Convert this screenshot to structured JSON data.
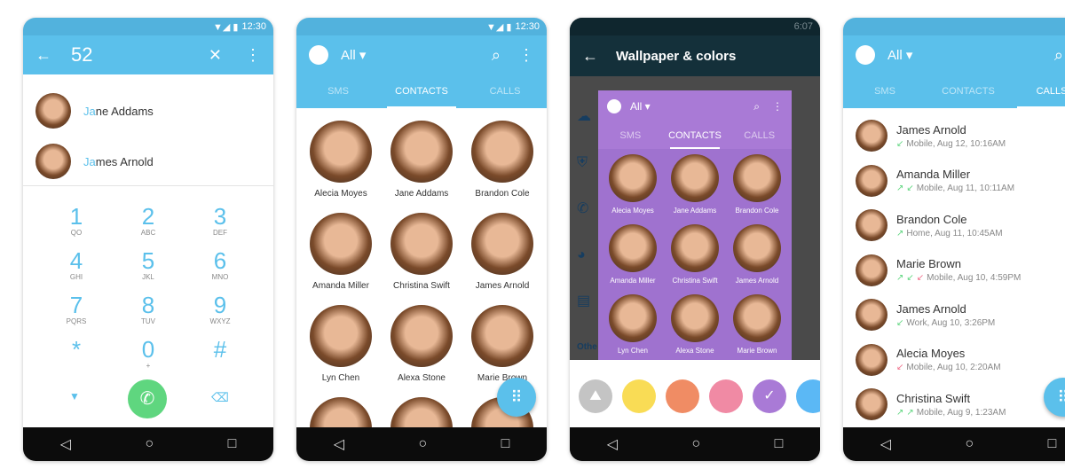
{
  "status": {
    "time1": "12:30",
    "time3": "6:07"
  },
  "dialer": {
    "number": "52",
    "matches": [
      {
        "hl": "Ja",
        "rest": "ne Addams"
      },
      {
        "hl": "Ja",
        "rest": "mes Arnold"
      }
    ],
    "keys": [
      {
        "d": "1",
        "l": "QO"
      },
      {
        "d": "2",
        "l": "ABC"
      },
      {
        "d": "3",
        "l": "DEF"
      },
      {
        "d": "4",
        "l": "GHI"
      },
      {
        "d": "5",
        "l": "JKL"
      },
      {
        "d": "6",
        "l": "MNO"
      },
      {
        "d": "7",
        "l": "PQRS"
      },
      {
        "d": "8",
        "l": "TUV"
      },
      {
        "d": "9",
        "l": "WXYZ"
      },
      {
        "d": "*",
        "l": ""
      },
      {
        "d": "0",
        "l": "+"
      },
      {
        "d": "#",
        "l": ""
      }
    ]
  },
  "header": {
    "filter": "All"
  },
  "tabs": [
    "SMS",
    "CONTACTS",
    "CALLS"
  ],
  "contacts": [
    "Alecia Moyes",
    "Jane Addams",
    "Brandon Cole",
    "Amanda Miller",
    "Christina Swift",
    "James Arnold",
    "Lyn Chen",
    "Alexa Stone",
    "Marie Brown"
  ],
  "wallpaper": {
    "title": "Wallpaper & colors",
    "side_label": "Othe",
    "colors": [
      "#c4c4c4",
      "#f9dc55",
      "#f08c64",
      "#f08aa4",
      "#a97ad6",
      "#5bb8f5"
    ],
    "selected": 4
  },
  "calls": [
    {
      "name": "James Arnold",
      "icons": [
        "in"
      ],
      "detail": "Mobile, Aug 12, 10:16AM"
    },
    {
      "name": "Amanda Miller",
      "icons": [
        "out",
        "in"
      ],
      "detail": "Mobile, Aug 11, 10:11AM"
    },
    {
      "name": "Brandon Cole",
      "icons": [
        "out"
      ],
      "detail": "Home, Aug 11, 10:45AM"
    },
    {
      "name": "Marie Brown",
      "icons": [
        "out",
        "in",
        "missed"
      ],
      "detail": "Mobile, Aug 10, 4:59PM"
    },
    {
      "name": "James Arnold",
      "icons": [
        "in"
      ],
      "detail": "Work, Aug 10, 3:26PM"
    },
    {
      "name": "Alecia Moyes",
      "icons": [
        "missed"
      ],
      "detail": "Mobile, Aug 10, 2:20AM"
    },
    {
      "name": "Christina Swift",
      "icons": [
        "out",
        "out"
      ],
      "detail": "Mobile, Aug 9, 1:23AM"
    }
  ],
  "colors": {
    "accent": "#5bc0eb",
    "call_green": "#5fd67f",
    "missed": "#f06e8a",
    "purple": "#a97ad6",
    "dark": "#14303a"
  }
}
